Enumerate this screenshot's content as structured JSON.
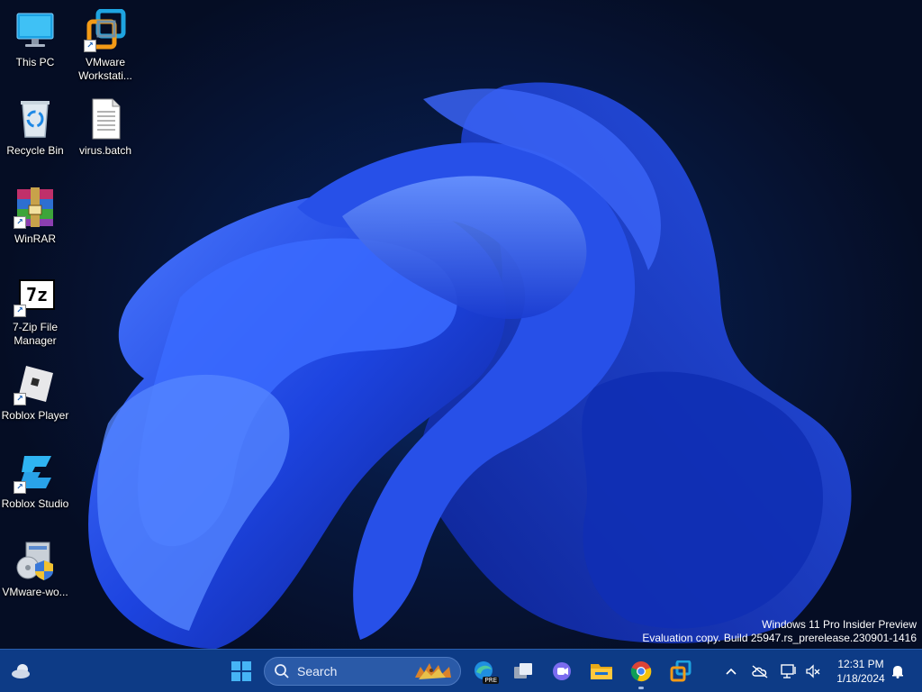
{
  "desktop": {
    "icons": [
      {
        "label": "This PC"
      },
      {
        "label": "VMware Workstati..."
      },
      {
        "label": "Recycle Bin"
      },
      {
        "label": "virus.batch"
      },
      {
        "label": "WinRAR"
      },
      {
        "label": "7-Zip File Manager"
      },
      {
        "label": "Roblox Player"
      },
      {
        "label": "Roblox Studio"
      },
      {
        "label": "VMware-wo..."
      }
    ],
    "zip_icon_text": "7z",
    "watermark": {
      "line1": "Windows 11 Pro Insider Preview",
      "line2": "Evaluation copy. Build 25947.rs_prerelease.230901-1416"
    }
  },
  "taskbar": {
    "search_placeholder": "Search",
    "edge_badge": "PRE",
    "clock": {
      "time": "12:31 PM",
      "date": "1/18/2024"
    }
  },
  "colors": {
    "taskbar": "#0d3b86",
    "accent": "#1f6fd6",
    "bloom": "#1e48e6"
  }
}
